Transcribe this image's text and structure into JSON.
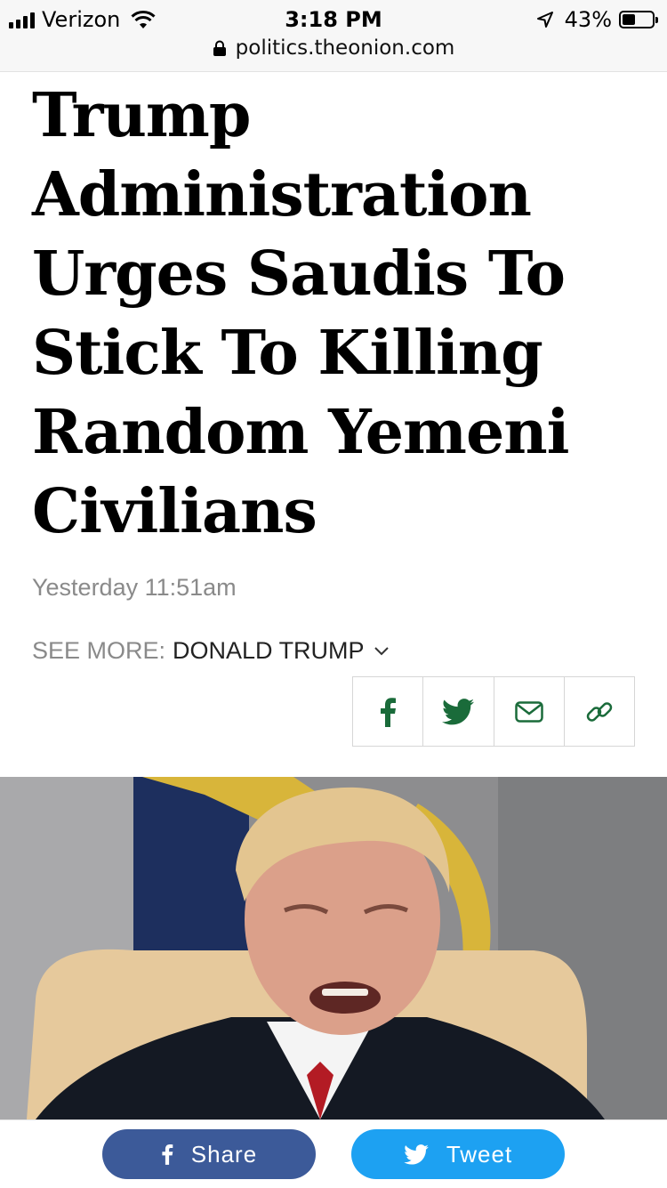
{
  "status_bar": {
    "carrier": "Verizon",
    "time": "3:18 PM",
    "battery_percent": "43%",
    "battery_level": 0.43,
    "icons": [
      "signal-icon",
      "wifi-icon",
      "location-icon",
      "battery-icon"
    ]
  },
  "address_bar": {
    "url": "politics.theonion.com",
    "icon": "lock-icon"
  },
  "article": {
    "headline": "Trump Administration Urges Saudis To Stick To Killing Random Yemeni Civilians",
    "timestamp": "Yesterday 11:51am",
    "see_more_label": "SEE MORE:",
    "see_more_tag": "DONALD TRUMP",
    "share_icons": [
      "facebook-icon",
      "twitter-icon",
      "email-icon",
      "link-icon"
    ],
    "share_icon_color": "#1a6b3a"
  },
  "bottom_bar": {
    "share_label": "Share",
    "tweet_label": "Tweet",
    "facebook_color": "#3c5a99",
    "twitter_color": "#1da1f2"
  }
}
